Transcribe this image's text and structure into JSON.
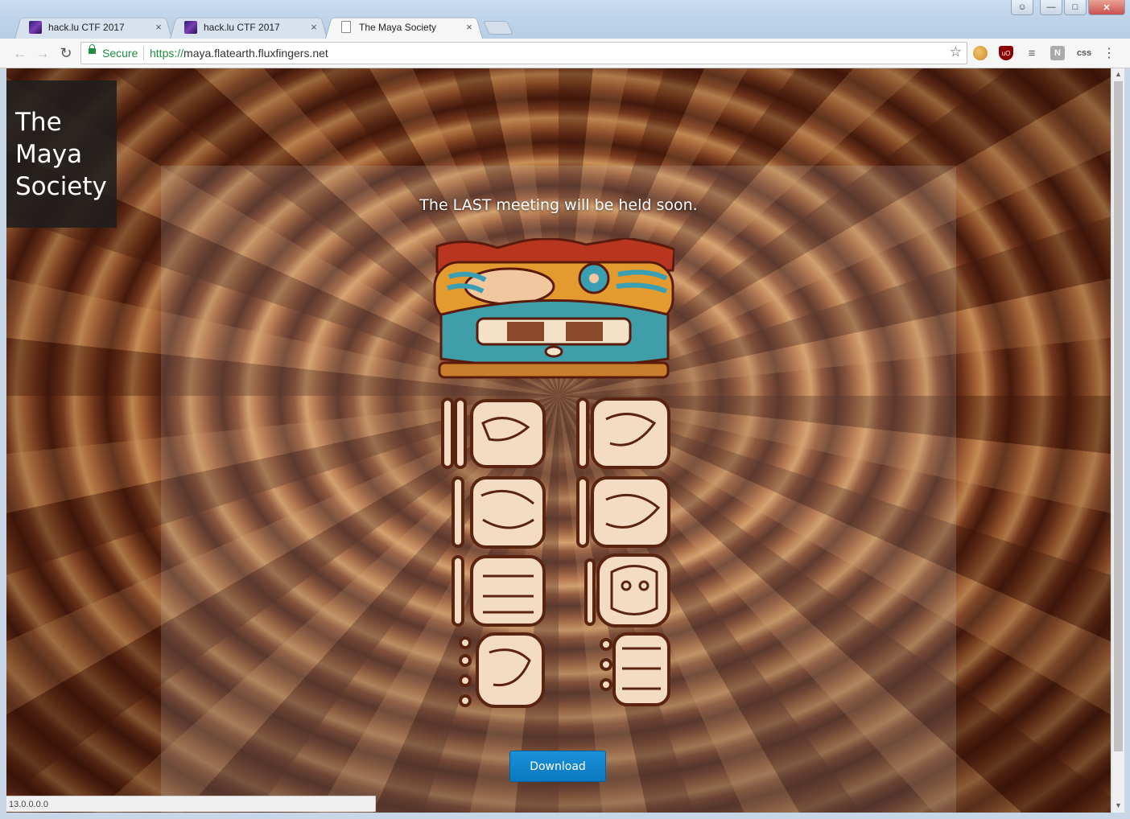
{
  "browser": {
    "tabs": [
      {
        "title": "hack.lu CTF 2017",
        "close": "×"
      },
      {
        "title": "hack.lu CTF 2017",
        "close": "×"
      },
      {
        "title": "The Maya Society",
        "close": "×"
      }
    ],
    "secure_label": "Secure",
    "url_scheme": "https://",
    "url_host": "maya.flatearth.fluxfingers.net",
    "ext_css": "css",
    "ext_notion": "N",
    "ext_ublock": "uO"
  },
  "site": {
    "brand_lines": [
      "The",
      "Maya",
      "Society"
    ],
    "tagline": "The LAST meeting will be held soon.",
    "download_label": "Download"
  },
  "status": {
    "text": "13.0.0.0.0"
  },
  "colors": {
    "download_button": "#0a78c0",
    "secure_green": "#1e8e3e"
  }
}
